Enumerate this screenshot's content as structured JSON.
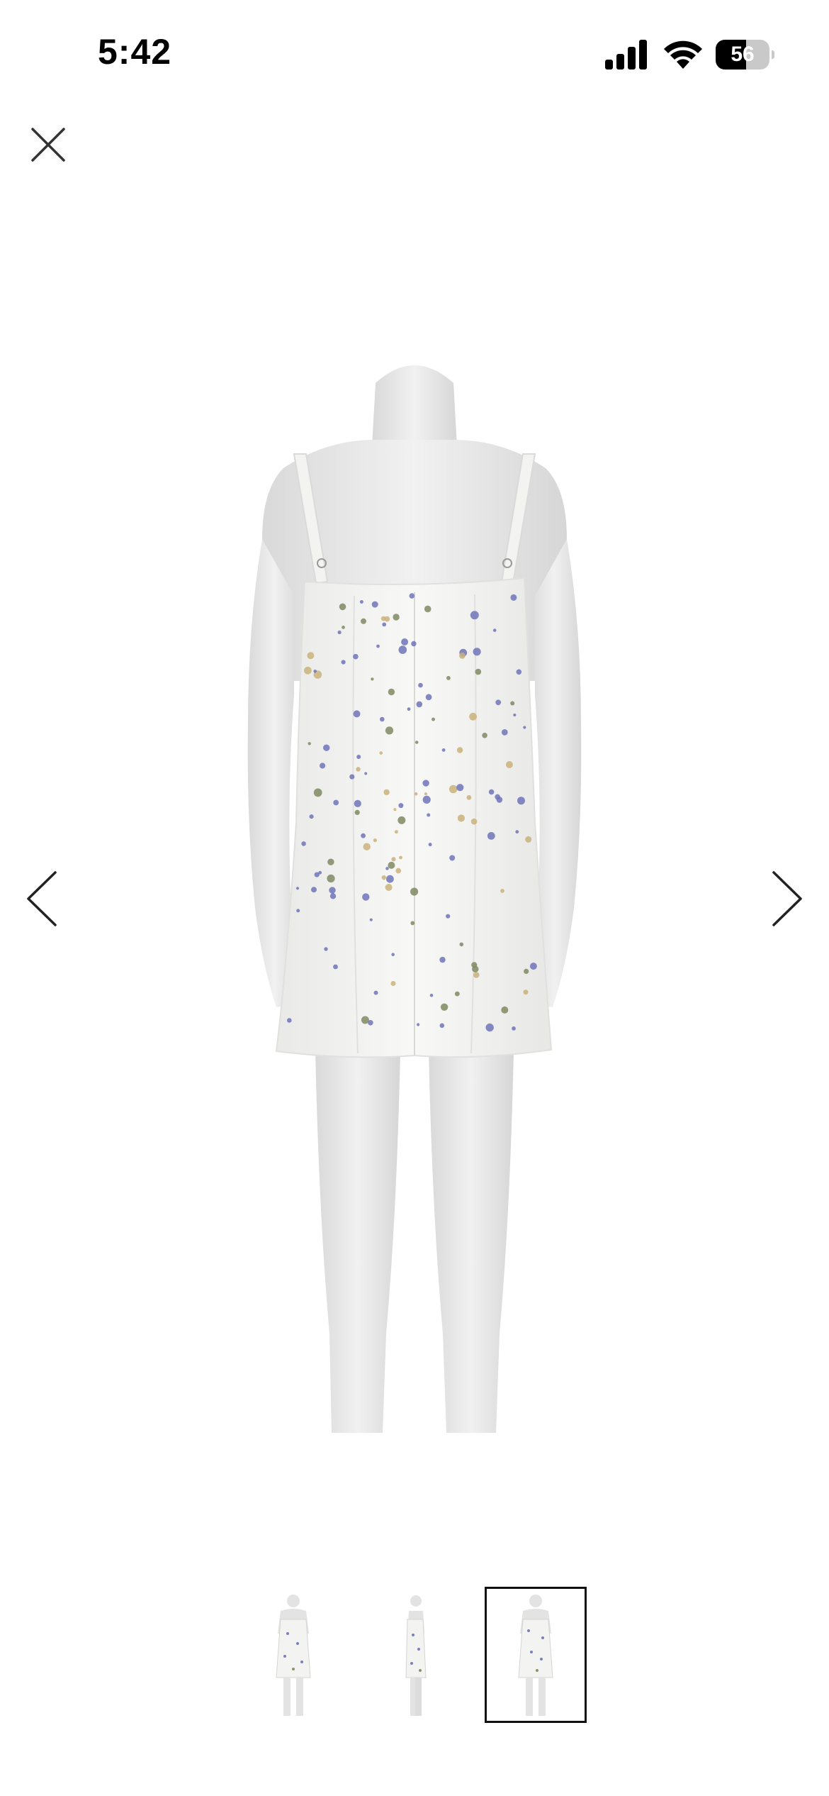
{
  "status_bar": {
    "time": "5:42",
    "battery_percent": "56",
    "battery_level": 0.56,
    "icons": [
      "cellular-signal-icon",
      "wifi-icon",
      "battery-icon"
    ]
  },
  "viewer": {
    "close_icon": "close-icon",
    "prev_icon": "chevron-left-icon",
    "next_icon": "chevron-right-icon",
    "main_image": "mannequin-back-view-floral-mini-dress",
    "thumbnails": [
      {
        "image": "mannequin-front-view-floral-mini-dress",
        "selected": false
      },
      {
        "image": "mannequin-side-view-floral-mini-dress",
        "selected": false
      },
      {
        "image": "mannequin-back-view-floral-mini-dress",
        "selected": true
      }
    ]
  },
  "colors": {
    "background": "#ffffff",
    "mannequin": "#e6e6e6",
    "dress": "#f4f4f2",
    "flower_blue": "#6f74b8",
    "flower_green": "#7f8a62",
    "flower_yellow": "#c9b27a",
    "selected_border": "#111111"
  }
}
